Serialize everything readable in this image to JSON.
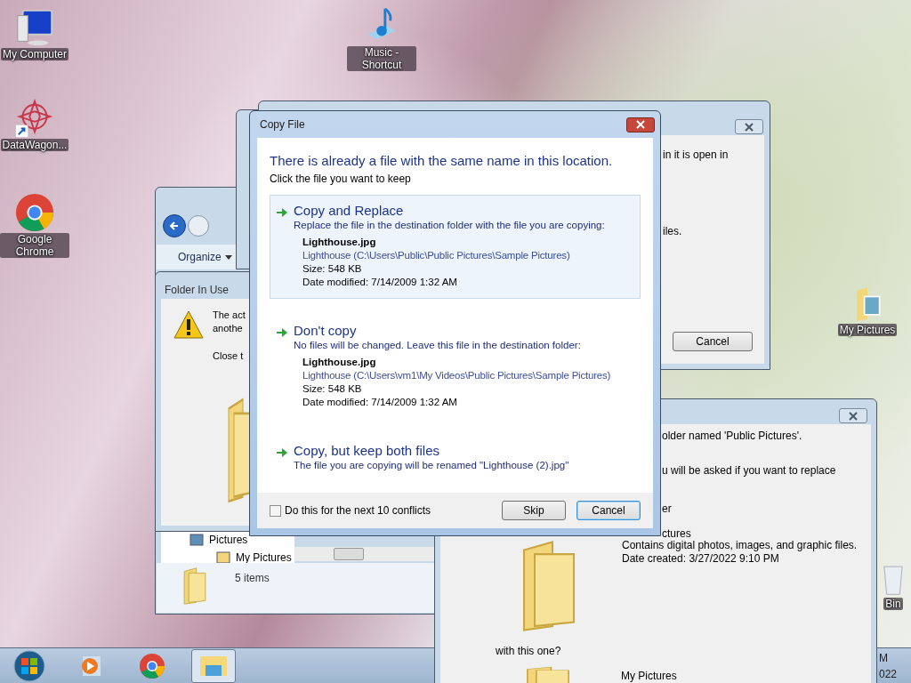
{
  "desktop_icons": [
    {
      "kind": "computer",
      "label": "My Computer"
    },
    {
      "kind": "app",
      "label": "DataWagon..."
    },
    {
      "kind": "chrome",
      "label": "Google Chrome"
    },
    {
      "kind": "music",
      "label": "Music - Shortcut"
    },
    {
      "kind": "pictures",
      "label": "My Pictures"
    },
    {
      "kind": "recycle",
      "label": "Bin"
    }
  ],
  "explorer_window": {
    "toolbar_button": "Organize",
    "tree": [
      {
        "label": "Pictures",
        "children": [
          {
            "label": "My Pictures"
          }
        ]
      }
    ],
    "status": "5 items"
  },
  "folder_in_use_window": {
    "title": "Folder In Use",
    "lines": [
      "The act",
      "anothe"
    ],
    "note": "Close t"
  },
  "file_in_use_window": {
    "lines": [
      "in it is open in",
      "iles."
    ],
    "button": "Cancel"
  },
  "confirm_folder_window": {
    "lines": [
      "older named 'Public Pictures'.",
      "u will be asked if you want to replace"
    ],
    "fragments": [
      "er",
      "ctures"
    ],
    "details": [
      "Contains digital photos, images, and graphic files.",
      "Date created: 3/27/2022 9:10 PM"
    ],
    "question": "with this one?",
    "folder_name": "My Pictures"
  },
  "dialog": {
    "title": "Copy File",
    "heading": "There is already a file with the same name in this location.",
    "subheading": "Click the file you want to keep",
    "options": [
      {
        "title": "Copy and Replace",
        "description": "Replace the file in the destination folder with the file you are copying:",
        "highlighted": true,
        "file": {
          "name": "Lighthouse.jpg",
          "path": "Lighthouse (C:\\Users\\Public\\Public Pictures\\Sample Pictures)",
          "size": "Size: 548 KB",
          "modified": "Date modified: 7/14/2009 1:32 AM"
        }
      },
      {
        "title": "Don't copy",
        "description": "No files will be changed. Leave this file in the destination folder:",
        "highlighted": false,
        "file": {
          "name": "Lighthouse.jpg",
          "path": "Lighthouse (C:\\Users\\vm1\\My Videos\\Public Pictures\\Sample Pictures)",
          "size": "Size: 548 KB",
          "modified": "Date modified: 7/14/2009 1:32 AM"
        }
      },
      {
        "title": "Copy, but keep both files",
        "description": "The file you are copying will be renamed \"Lighthouse (2).jpg\"",
        "highlighted": false
      }
    ],
    "checkbox": {
      "label": "Do this for the next 10 conflicts",
      "checked": false
    },
    "buttons": [
      {
        "label": "Skip",
        "default": false
      },
      {
        "label": "Cancel",
        "default": true
      }
    ]
  },
  "taskbar": {
    "items": [
      {
        "kind": "start",
        "selected": false
      },
      {
        "kind": "media",
        "selected": false
      },
      {
        "kind": "chrome",
        "selected": false
      },
      {
        "kind": "explorer",
        "selected": true
      }
    ],
    "clock": [
      "M",
      "022"
    ]
  }
}
